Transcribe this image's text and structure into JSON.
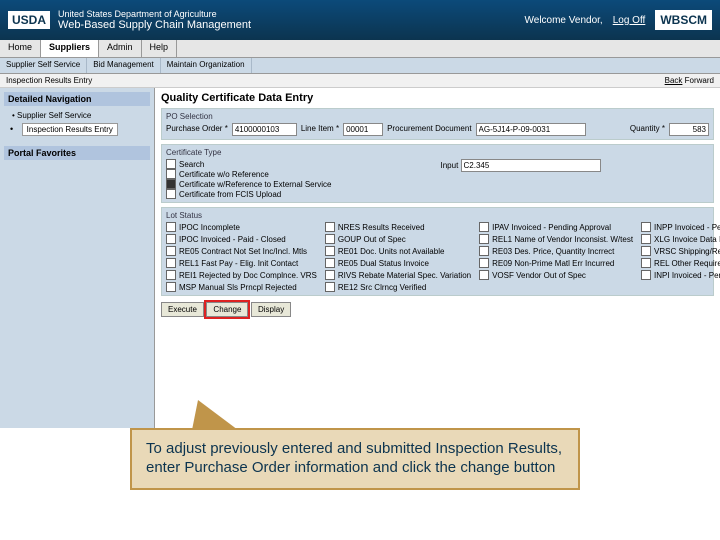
{
  "header": {
    "dept": "United States Department of Agriculture",
    "app": "Web-Based Supply Chain Management",
    "welcome": "Welcome Vendor,",
    "logoff": "Log Off",
    "logo": "USDA",
    "brand": "WBSCM"
  },
  "tabs": [
    "Home",
    "Suppliers",
    "Admin",
    "Help"
  ],
  "active_tab": "Suppliers",
  "subtabs": [
    "Supplier Self Service",
    "Bid Management",
    "Maintain Organization"
  ],
  "breadcrumb": {
    "title": "Inspection Results Entry",
    "back": "Back",
    "forward": "Forward"
  },
  "side": {
    "nav_hdr": "Detailed Navigation",
    "items": [
      "Supplier Self Service",
      "Inspection Results Entry"
    ],
    "fav_hdr": "Portal Favorites"
  },
  "page": {
    "title": "Quality Certificate Data Entry",
    "po_section": "PO Selection",
    "po_label": "Purchase Order *",
    "po_val": "4100000103",
    "line_label": "Line Item *",
    "line_val": "00001",
    "procdoc_label": "Procurement Document",
    "procdoc_val": "AG-5J14-P-09-0031",
    "qty_label": "Quantity *",
    "qty_val": "583"
  },
  "cert": {
    "title": "Certificate Type",
    "opts": [
      "Search",
      "Certificate w/o Reference",
      "Certificate w/Reference to External Service",
      "Certificate from FCIS Upload"
    ],
    "input_lbl": "Input",
    "input_val": "C2.345"
  },
  "lot": {
    "title": "Lot Status",
    "col1": [
      "IPOC Incomplete",
      "IPOC Invoiced - Paid - Closed",
      "RE05 Contract Not Set Inc/Incl. Mtls",
      "REL1 Fast Pay - Elig. Init Contact",
      "REI1 Rejected by Doc Complnce. VRS",
      "MSP Manual Sls Prncpl Rejected"
    ],
    "col2": [
      "NRES Results Received",
      "GOUP Out of Spec",
      "RE01 Doc. Units not Available",
      "RE05 Dual Status Invoice",
      "RIVS Rebate Material Spec. Variation",
      "RE12 Src Clrncg Verified"
    ],
    "col3": [
      "IPAV Invoiced - Pending Approval",
      "REL1 Name of Vendor Inconsist. W/test",
      "RE03 Des. Price, Quantity Incrrect",
      "RE09 Non-Prime Matl Err Incurred",
      "VOSF Vendor Out of Spec"
    ],
    "col4": [
      "INPP Invoiced - Pending Payment",
      "XLG Invoice Data Inconsistencies",
      "VRSC Shipping/Receipt Dates Incons.",
      "REL Other Required Documents Met",
      "INPI Invoiced - Pending Approval"
    ]
  },
  "buttons": {
    "execute": "Execute",
    "change": "Change",
    "display": "Display"
  },
  "callout": "To adjust previously entered and submitted Inspection Results, enter Purchase Order information and click the change button"
}
